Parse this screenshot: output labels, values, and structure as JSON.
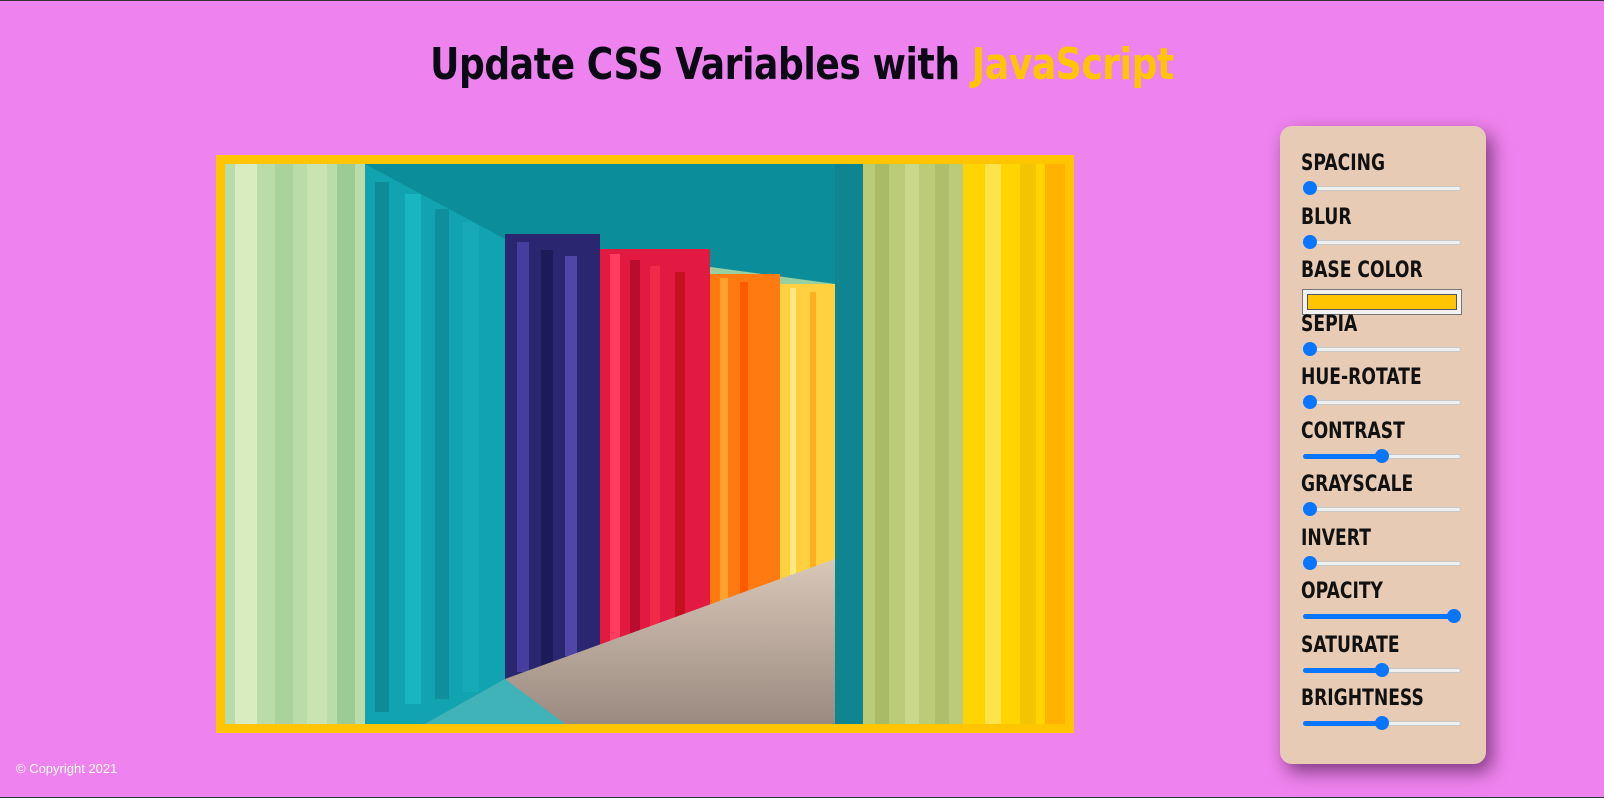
{
  "header": {
    "title_prefix": "Update CSS Variables with ",
    "title_highlight": "JavaScript"
  },
  "colors": {
    "background": "#ee82ee",
    "accent": "#ffc600",
    "panel": "#e8cbb5",
    "slider": "#0a75ff"
  },
  "image": {
    "description_icon": "rainbow-tunnel-image"
  },
  "controls": [
    {
      "label": "SPACING",
      "type": "range",
      "value_fraction": 0.0
    },
    {
      "label": "BLUR",
      "type": "range",
      "value_fraction": 0.0
    },
    {
      "label": "BASE COLOR",
      "type": "color",
      "value": "#ffc600"
    },
    {
      "label": "SEPIA",
      "type": "range",
      "value_fraction": 0.0
    },
    {
      "label": "HUE-ROTATE",
      "type": "range",
      "value_fraction": 0.0
    },
    {
      "label": "CONTRAST",
      "type": "range",
      "value_fraction": 0.5
    },
    {
      "label": "GRAYSCALE",
      "type": "range",
      "value_fraction": 0.0
    },
    {
      "label": "INVERT",
      "type": "range",
      "value_fraction": 0.0
    },
    {
      "label": "OPACITY",
      "type": "range",
      "value_fraction": 1.0
    },
    {
      "label": "SATURATE",
      "type": "range",
      "value_fraction": 0.5
    },
    {
      "label": "BRIGHTNESS",
      "type": "range",
      "value_fraction": 0.5
    }
  ],
  "footer": {
    "copyright": "© Copyright 2021"
  }
}
